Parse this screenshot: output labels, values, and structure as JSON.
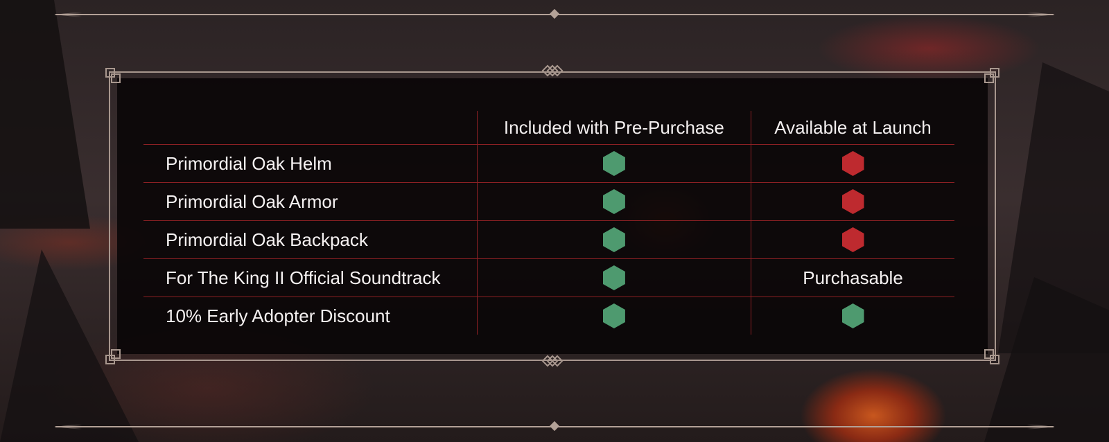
{
  "colors": {
    "included": "#4e9a6f",
    "excluded": "#be2a2f",
    "frame": "#a8978e",
    "divider": "#8e2024"
  },
  "table": {
    "headers": {
      "item": "",
      "pre_purchase": "Included with Pre-Purchase",
      "launch": "Available at Launch"
    },
    "rows": [
      {
        "item": "Primordial Oak Helm",
        "pre_purchase": "green-hexagon",
        "launch": "red-hexagon",
        "launch_text": ""
      },
      {
        "item": "Primordial Oak Armor",
        "pre_purchase": "green-hexagon",
        "launch": "red-hexagon",
        "launch_text": ""
      },
      {
        "item": "Primordial Oak Backpack",
        "pre_purchase": "green-hexagon",
        "launch": "red-hexagon",
        "launch_text": ""
      },
      {
        "item": "For The King II Official Soundtrack",
        "pre_purchase": "green-hexagon",
        "launch": "text",
        "launch_text": "Purchasable"
      },
      {
        "item": "10% Early Adopter Discount",
        "pre_purchase": "green-hexagon",
        "launch": "green-hexagon",
        "launch_text": ""
      }
    ]
  }
}
